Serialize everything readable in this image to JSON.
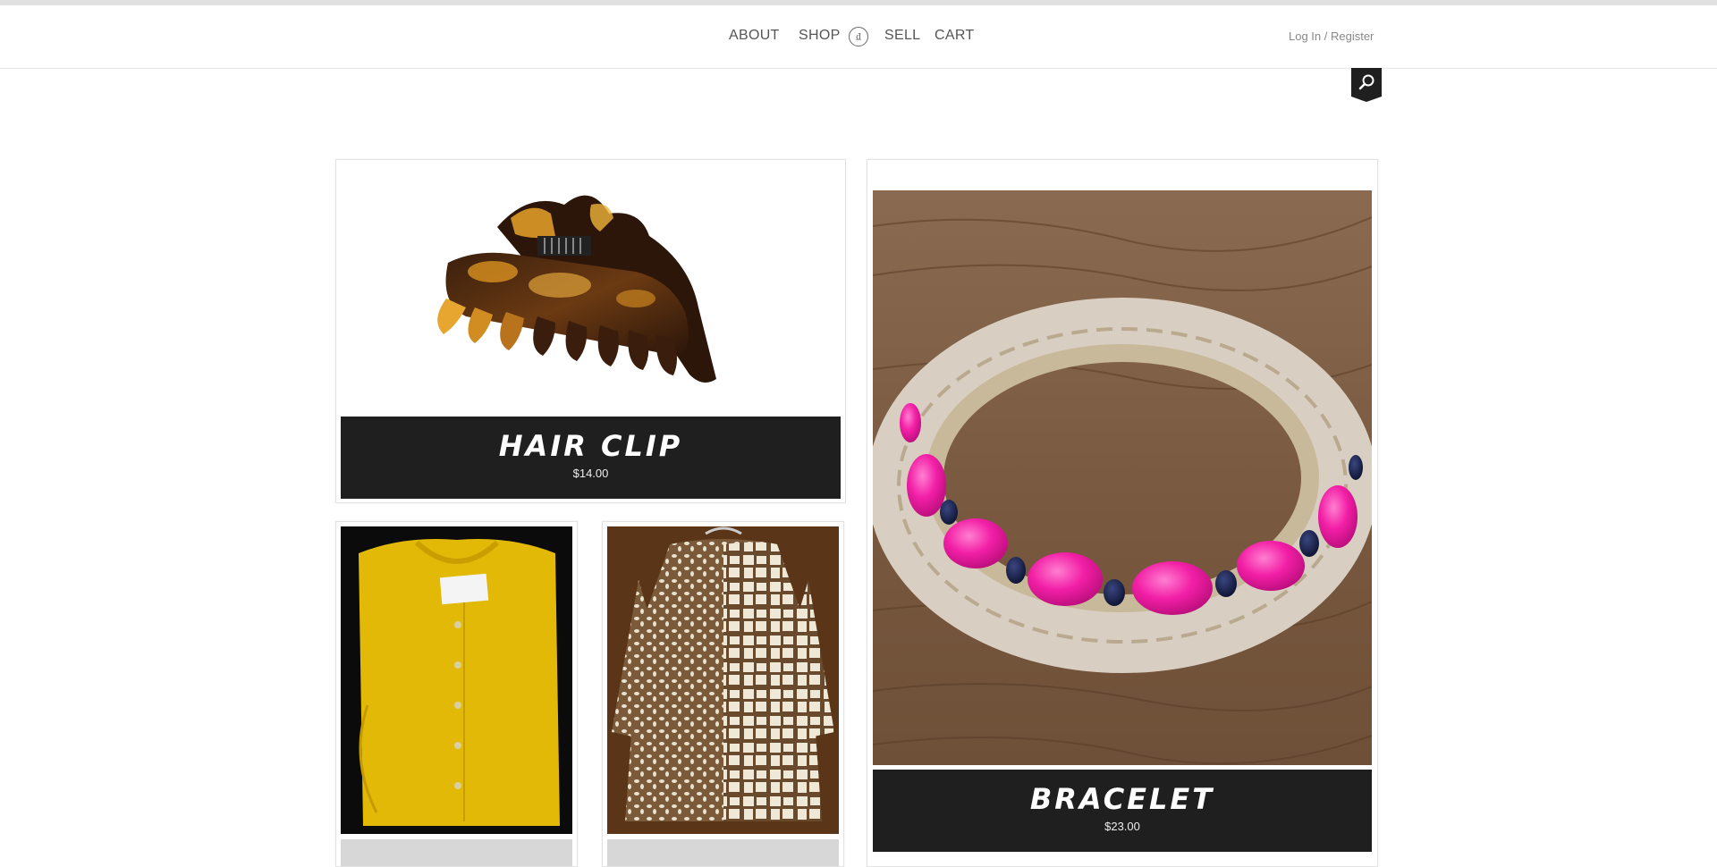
{
  "nav": {
    "about": "ABOUT",
    "shop": "SHOP",
    "logo_text": "₫",
    "sell": "SELL",
    "cart": "CART",
    "login": "Log In / Register"
  },
  "search": {
    "icon": "search-icon"
  },
  "products": {
    "hair_clip": {
      "title": "HAIR CLIP",
      "price": "$14.00"
    },
    "bracelet": {
      "title": "BRACELET",
      "price": "$23.00"
    }
  },
  "colors": {
    "label_bar": "#1f1f1f",
    "sweater_yellow": "#e3b907",
    "bracelet_pink": "#f21fa6"
  }
}
